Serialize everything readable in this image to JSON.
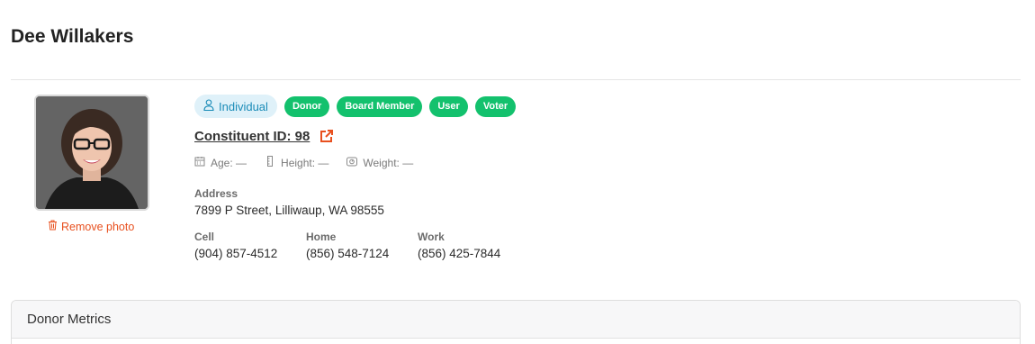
{
  "page": {
    "title": "Dee Willakers"
  },
  "photo": {
    "remove_label": "Remove photo"
  },
  "badges": {
    "individual": "Individual",
    "tags": [
      "Donor",
      "Board Member",
      "User",
      "Voter"
    ]
  },
  "constituent": {
    "id_label": "Constituent ID: 98"
  },
  "vitals": {
    "age": "Age: —",
    "height": "Height: —",
    "weight": "Weight: —"
  },
  "address": {
    "label": "Address",
    "value": "7899 P Street, Lilliwaup, WA 98555"
  },
  "phones": {
    "cell_label": "Cell",
    "cell_value": "(904) 857-4512",
    "home_label": "Home",
    "home_value": "(856) 548-7124",
    "work_label": "Work",
    "work_value": "(856) 425-7844"
  },
  "panel": {
    "title": "Donor Metrics"
  },
  "colors": {
    "tag_green": "#13c16d",
    "individual_bg": "#dff1f9",
    "individual_text": "#1b8cb8",
    "accent_orange": "#e8501f"
  },
  "icons": {
    "individual": "person-icon",
    "external": "external-link-icon",
    "remove": "trash-icon",
    "age": "calendar-icon",
    "height": "ruler-icon",
    "weight": "scale-icon"
  }
}
